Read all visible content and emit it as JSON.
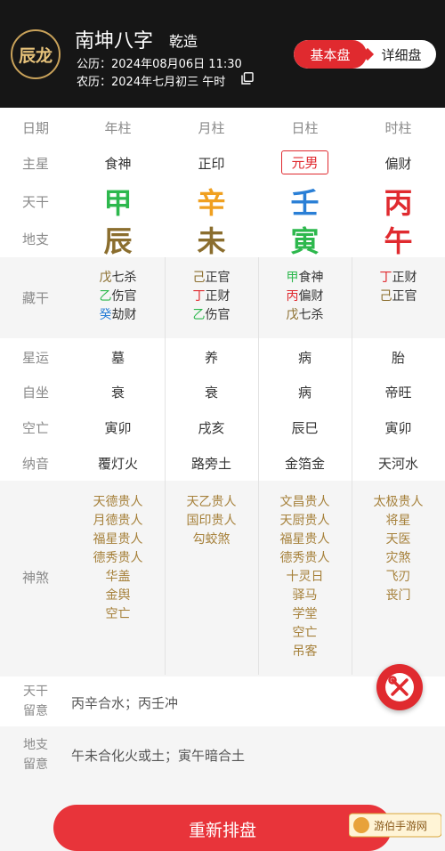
{
  "header": {
    "avatar_text": "辰龙",
    "name": "南坤八字",
    "gender": "乾造",
    "solar": "公历：2024年08月06日 11:30",
    "lunar": "农历：2024年七月初三 午时",
    "tabs": {
      "basic": "基本盘",
      "detail": "详细盘"
    }
  },
  "columns": [
    "年柱",
    "月柱",
    "日柱",
    "时柱"
  ],
  "labels": {
    "date": "日期",
    "main_star": "主星",
    "tiangan": "天干",
    "dizhi": "地支",
    "canggan": "藏干",
    "xingyun": "星运",
    "zizuo": "自坐",
    "kongwang": "空亡",
    "nayin": "纳音",
    "shensha": "神煞",
    "tg_note": "天干\n留意",
    "dz_note": "地支\n留意"
  },
  "main_star": [
    "食神",
    "正印",
    "元男",
    "偏财"
  ],
  "tiangan": [
    {
      "char": "甲",
      "color": "#2db84d"
    },
    {
      "char": "辛",
      "color": "#f0a020"
    },
    {
      "char": "壬",
      "color": "#2a7fd6"
    },
    {
      "char": "丙",
      "color": "#e02a2f"
    }
  ],
  "dizhi": [
    {
      "char": "辰",
      "color": "#8b6e2e"
    },
    {
      "char": "未",
      "color": "#8b6e2e"
    },
    {
      "char": "寅",
      "color": "#2db84d"
    },
    {
      "char": "午",
      "color": "#e02a2f"
    }
  ],
  "canggan": [
    [
      {
        "g": "戊",
        "c": "#8b6e2e",
        "t": "七杀"
      },
      {
        "g": "乙",
        "c": "#2db84d",
        "t": "伤官"
      },
      {
        "g": "癸",
        "c": "#2a7fd6",
        "t": "劫财"
      }
    ],
    [
      {
        "g": "己",
        "c": "#8b6e2e",
        "t": "正官"
      },
      {
        "g": "丁",
        "c": "#e02a2f",
        "t": "正财"
      },
      {
        "g": "乙",
        "c": "#2db84d",
        "t": "伤官"
      }
    ],
    [
      {
        "g": "甲",
        "c": "#2db84d",
        "t": "食神"
      },
      {
        "g": "丙",
        "c": "#e02a2f",
        "t": "偏财"
      },
      {
        "g": "戊",
        "c": "#8b6e2e",
        "t": "七杀"
      }
    ],
    [
      {
        "g": "丁",
        "c": "#e02a2f",
        "t": "正财"
      },
      {
        "g": "己",
        "c": "#8b6e2e",
        "t": "正官"
      }
    ]
  ],
  "xingyun": [
    "墓",
    "养",
    "病",
    "胎"
  ],
  "zizuo": [
    "衰",
    "衰",
    "病",
    "帝旺"
  ],
  "kongwang": [
    "寅卯",
    "戌亥",
    "辰巳",
    "寅卯"
  ],
  "nayin": [
    "覆灯火",
    "路旁土",
    "金箔金",
    "天河水"
  ],
  "shensha": [
    [
      "天德贵人",
      "月德贵人",
      "福星贵人",
      "德秀贵人",
      "华盖",
      "金舆",
      "空亡"
    ],
    [
      "天乙贵人",
      "国印贵人",
      "勾蛟煞"
    ],
    [
      "文昌贵人",
      "天厨贵人",
      "福星贵人",
      "德秀贵人",
      "十灵日",
      "驿马",
      "学堂",
      "空亡",
      "吊客"
    ],
    [
      "太极贵人",
      "将星",
      "天医",
      "灾煞",
      "飞刃",
      "丧门"
    ]
  ],
  "notes": {
    "tiangan": "丙辛合水；丙壬冲",
    "dizhi": "午未合化火或土；寅午暗合土"
  },
  "bottom_button": "重新排盘",
  "watermark": "游伯手游网",
  "icons": {
    "copy": "copy-icon",
    "tools": "tools-icon"
  }
}
